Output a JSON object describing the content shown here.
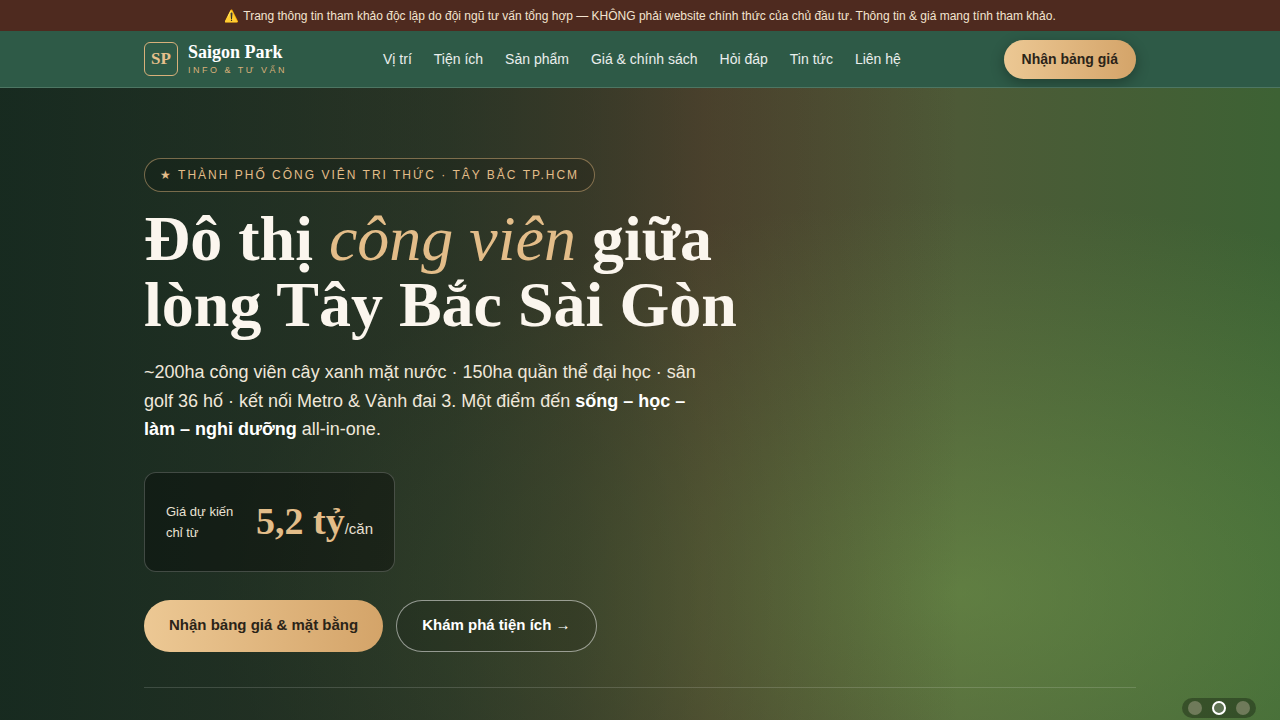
{
  "notice": {
    "icon": "⚠️",
    "text": "Trang thông tin tham khảo độc lập do đội ngũ tư vấn tổng hợp — KHÔNG phải website chính thức của chủ đầu tư. Thông tin & giá mang tính tham khảo."
  },
  "brand": {
    "logo": "SP",
    "name": "Saigon Park",
    "tagline": "INFO & TƯ VẤN"
  },
  "nav": [
    "Vị trí",
    "Tiện ích",
    "Sản phẩm",
    "Giá & chính sách",
    "Hỏi đáp",
    "Tin tức",
    "Liên hệ"
  ],
  "nav_button": "Nhận bảng giá",
  "hero": {
    "badge": "★ THÀNH PHỐ CÔNG VIÊN TRI THỨC · TÂY BẮC TP.HCM",
    "title_lines": [
      [
        {
          "text": "Đô thị ",
          "kind": "plain"
        },
        {
          "text": "công viên",
          "kind": "accent"
        },
        {
          "text": " giữa",
          "kind": "plain"
        }
      ],
      [
        {
          "text": "lòng Tây Bắc Sài Gòn",
          "kind": "plain"
        }
      ]
    ],
    "subtitle": [
      {
        "text": "~200ha công viên cây xanh mặt nước · 150ha quần thể đại học · sân golf 36 hố · kết nối Metro & Vành đai 3. Một điểm đến ",
        "kind": "plain"
      },
      {
        "text": "sống – học – làm – nghỉ dưỡng",
        "kind": "bold"
      },
      {
        "text": " all-in-one.",
        "kind": "plain"
      }
    ],
    "price": {
      "label": "Giá dự kiến chỉ từ",
      "value": "5,2 tỷ",
      "unit": "/căn"
    },
    "buttons": [
      {
        "label": "Nhận bảng giá & mặt bằng",
        "kind": "primary"
      },
      {
        "label": "Khám phá tiện ích →",
        "kind": "outline"
      }
    ]
  },
  "slides": [
    {
      "selected": false
    },
    {
      "selected": true
    },
    {
      "selected": false
    }
  ]
}
